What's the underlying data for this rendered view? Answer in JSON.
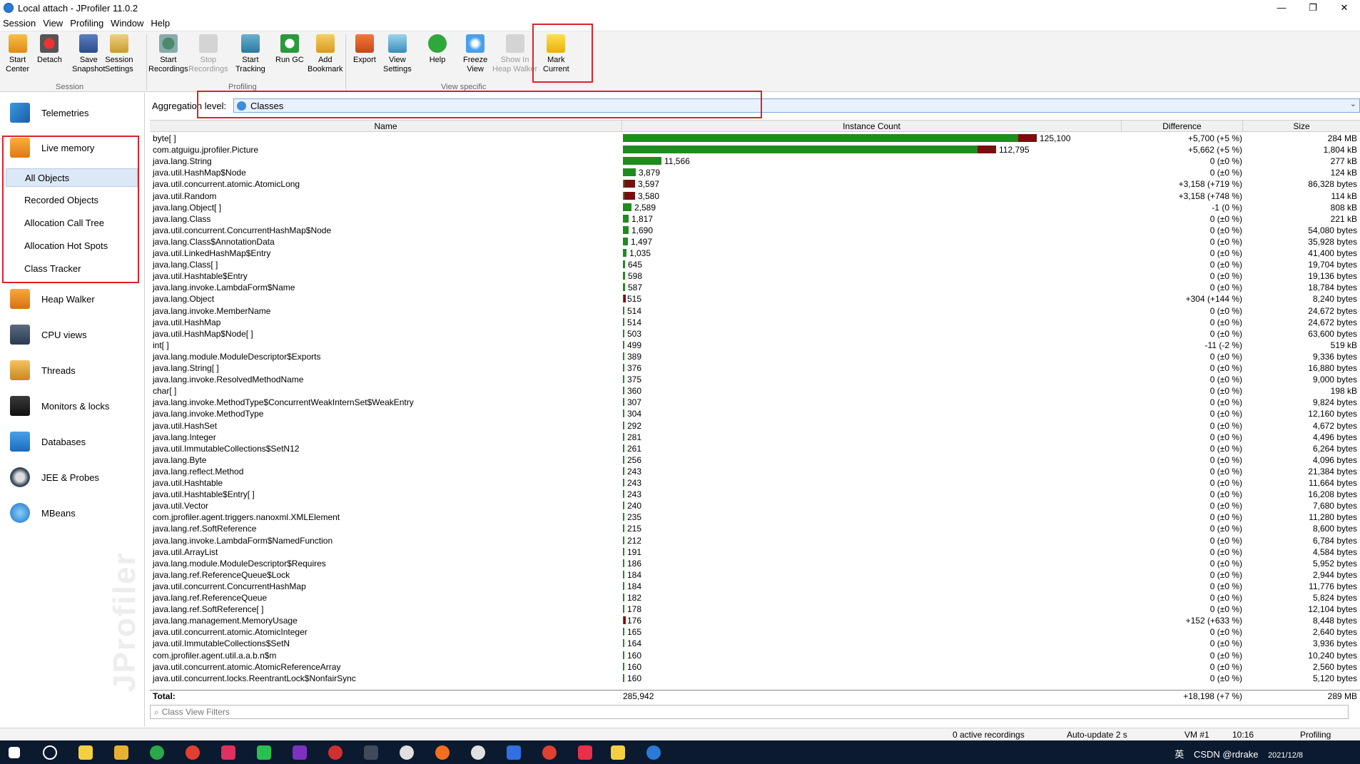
{
  "window": {
    "title": "Local attach - JProfiler 11.0.2",
    "controls": [
      "—",
      "❐",
      "✕"
    ]
  },
  "menu": [
    "Session",
    "View",
    "Profiling",
    "Window",
    "Help"
  ],
  "toolbar": {
    "session": [
      {
        "l1": "Start",
        "l2": "Center"
      },
      {
        "l1": "",
        "l2": "Detach"
      },
      {
        "l1": "Save",
        "l2": "Snapshot"
      },
      {
        "l1": "Session",
        "l2": "Settings"
      }
    ],
    "profiling": [
      {
        "l1": "Start",
        "l2": "Recordings"
      },
      {
        "l1": "Stop",
        "l2": "Recordings"
      },
      {
        "l1": "Start",
        "l2": "Tracking"
      },
      {
        "l1": "",
        "l2": "Run GC"
      },
      {
        "l1": "Add",
        "l2": "Bookmark"
      }
    ],
    "view": [
      {
        "l1": "",
        "l2": "Export"
      },
      {
        "l1": "View",
        "l2": "Settings"
      },
      {
        "l1": "",
        "l2": "Help"
      },
      {
        "l1": "Freeze",
        "l2": "View"
      },
      {
        "l1": "Show In",
        "l2": "Heap Walker"
      },
      {
        "l1": "Mark",
        "l2": "Current"
      }
    ],
    "groups": {
      "session": "Session",
      "profiling": "Profiling",
      "view": "View specific"
    }
  },
  "sidebar": {
    "telemetries": "Telemetries",
    "live_memory": "Live memory",
    "subs": [
      "All Objects",
      "Recorded Objects",
      "Allocation Call Tree",
      "Allocation Hot Spots",
      "Class Tracker"
    ],
    "items": [
      "Heap Walker",
      "CPU views",
      "Threads",
      "Monitors & locks",
      "Databases",
      "JEE & Probes",
      "MBeans"
    ],
    "watermark": "JProfiler"
  },
  "aggregation": {
    "label": "Aggregation level:",
    "value": "Classes"
  },
  "table": {
    "headers": {
      "name": "Name",
      "count": "Instance Count",
      "diff": "Difference",
      "size": "Size"
    },
    "max_count": 125100,
    "rows": [
      {
        "name": "byte[ ]",
        "count": "125,100",
        "n": 125100,
        "d": 5700,
        "diff": "+5,700 (+5 %)",
        "size": "284 MB"
      },
      {
        "name": "com.atguigu.jprofiler.Picture",
        "count": "112,795",
        "n": 112795,
        "d": 5662,
        "diff": "+5,662 (+5 %)",
        "size": "1,804 kB"
      },
      {
        "name": "java.lang.String",
        "count": "11,566",
        "n": 11566,
        "d": 0,
        "diff": "0 (±0 %)",
        "size": "277 kB"
      },
      {
        "name": "java.util.HashMap$Node",
        "count": "3,879",
        "n": 3879,
        "d": 0,
        "diff": "0 (±0 %)",
        "size": "124 kB"
      },
      {
        "name": "java.util.concurrent.atomic.AtomicLong",
        "count": "3,597",
        "n": 3597,
        "d": 3158,
        "diff": "+3,158 (+719 %)",
        "size": "86,328 bytes"
      },
      {
        "name": "java.util.Random",
        "count": "3,580",
        "n": 3580,
        "d": 3158,
        "diff": "+3,158 (+748 %)",
        "size": "114 kB"
      },
      {
        "name": "java.lang.Object[ ]",
        "count": "2,589",
        "n": 2589,
        "d": 0,
        "diff": "-1 (0 %)",
        "size": "808 kB"
      },
      {
        "name": "java.lang.Class",
        "count": "1,817",
        "n": 1817,
        "d": 0,
        "diff": "0 (±0 %)",
        "size": "221 kB"
      },
      {
        "name": "java.util.concurrent.ConcurrentHashMap$Node",
        "count": "1,690",
        "n": 1690,
        "d": 0,
        "diff": "0 (±0 %)",
        "size": "54,080 bytes"
      },
      {
        "name": "java.lang.Class$AnnotationData",
        "count": "1,497",
        "n": 1497,
        "d": 0,
        "diff": "0 (±0 %)",
        "size": "35,928 bytes"
      },
      {
        "name": "java.util.LinkedHashMap$Entry",
        "count": "1,035",
        "n": 1035,
        "d": 0,
        "diff": "0 (±0 %)",
        "size": "41,400 bytes"
      },
      {
        "name": "java.lang.Class[ ]",
        "count": "645",
        "n": 645,
        "d": 0,
        "diff": "0 (±0 %)",
        "size": "19,704 bytes"
      },
      {
        "name": "java.util.Hashtable$Entry",
        "count": "598",
        "n": 598,
        "d": 0,
        "diff": "0 (±0 %)",
        "size": "19,136 bytes"
      },
      {
        "name": "java.lang.invoke.LambdaForm$Name",
        "count": "587",
        "n": 587,
        "d": 0,
        "diff": "0 (±0 %)",
        "size": "18,784 bytes"
      },
      {
        "name": "java.lang.Object",
        "count": "515",
        "n": 515,
        "d": 304,
        "diff": "+304 (+144 %)",
        "size": "8,240 bytes"
      },
      {
        "name": "java.lang.invoke.MemberName",
        "count": "514",
        "n": 514,
        "d": 0,
        "diff": "0 (±0 %)",
        "size": "24,672 bytes"
      },
      {
        "name": "java.util.HashMap",
        "count": "514",
        "n": 514,
        "d": 0,
        "diff": "0 (±0 %)",
        "size": "24,672 bytes"
      },
      {
        "name": "java.util.HashMap$Node[ ]",
        "count": "503",
        "n": 503,
        "d": 0,
        "diff": "0 (±0 %)",
        "size": "63,600 bytes"
      },
      {
        "name": "int[ ]",
        "count": "499",
        "n": 499,
        "d": 0,
        "diff": "-11 (-2 %)",
        "size": "519 kB"
      },
      {
        "name": "java.lang.module.ModuleDescriptor$Exports",
        "count": "389",
        "n": 389,
        "d": 0,
        "diff": "0 (±0 %)",
        "size": "9,336 bytes"
      },
      {
        "name": "java.lang.String[ ]",
        "count": "376",
        "n": 376,
        "d": 0,
        "diff": "0 (±0 %)",
        "size": "16,880 bytes"
      },
      {
        "name": "java.lang.invoke.ResolvedMethodName",
        "count": "375",
        "n": 375,
        "d": 0,
        "diff": "0 (±0 %)",
        "size": "9,000 bytes"
      },
      {
        "name": "char[ ]",
        "count": "360",
        "n": 360,
        "d": 0,
        "diff": "0 (±0 %)",
        "size": "198 kB"
      },
      {
        "name": "java.lang.invoke.MethodType$ConcurrentWeakInternSet$WeakEntry",
        "count": "307",
        "n": 307,
        "d": 0,
        "diff": "0 (±0 %)",
        "size": "9,824 bytes"
      },
      {
        "name": "java.lang.invoke.MethodType",
        "count": "304",
        "n": 304,
        "d": 0,
        "diff": "0 (±0 %)",
        "size": "12,160 bytes"
      },
      {
        "name": "java.util.HashSet",
        "count": "292",
        "n": 292,
        "d": 0,
        "diff": "0 (±0 %)",
        "size": "4,672 bytes"
      },
      {
        "name": "java.lang.Integer",
        "count": "281",
        "n": 281,
        "d": 0,
        "diff": "0 (±0 %)",
        "size": "4,496 bytes"
      },
      {
        "name": "java.util.ImmutableCollections$SetN12",
        "count": "261",
        "n": 261,
        "d": 0,
        "diff": "0 (±0 %)",
        "size": "6,264 bytes"
      },
      {
        "name": "java.lang.Byte",
        "count": "256",
        "n": 256,
        "d": 0,
        "diff": "0 (±0 %)",
        "size": "4,096 bytes"
      },
      {
        "name": "java.lang.reflect.Method",
        "count": "243",
        "n": 243,
        "d": 0,
        "diff": "0 (±0 %)",
        "size": "21,384 bytes"
      },
      {
        "name": "java.util.Hashtable",
        "count": "243",
        "n": 243,
        "d": 0,
        "diff": "0 (±0 %)",
        "size": "11,664 bytes"
      },
      {
        "name": "java.util.Hashtable$Entry[ ]",
        "count": "243",
        "n": 243,
        "d": 0,
        "diff": "0 (±0 %)",
        "size": "16,208 bytes"
      },
      {
        "name": "java.util.Vector",
        "count": "240",
        "n": 240,
        "d": 0,
        "diff": "0 (±0 %)",
        "size": "7,680 bytes"
      },
      {
        "name": "com.jprofiler.agent.triggers.nanoxml.XMLElement",
        "count": "235",
        "n": 235,
        "d": 0,
        "diff": "0 (±0 %)",
        "size": "11,280 bytes"
      },
      {
        "name": "java.lang.ref.SoftReference",
        "count": "215",
        "n": 215,
        "d": 0,
        "diff": "0 (±0 %)",
        "size": "8,600 bytes"
      },
      {
        "name": "java.lang.invoke.LambdaForm$NamedFunction",
        "count": "212",
        "n": 212,
        "d": 0,
        "diff": "0 (±0 %)",
        "size": "6,784 bytes"
      },
      {
        "name": "java.util.ArrayList",
        "count": "191",
        "n": 191,
        "d": 0,
        "diff": "0 (±0 %)",
        "size": "4,584 bytes"
      },
      {
        "name": "java.lang.module.ModuleDescriptor$Requires",
        "count": "186",
        "n": 186,
        "d": 0,
        "diff": "0 (±0 %)",
        "size": "5,952 bytes"
      },
      {
        "name": "java.lang.ref.ReferenceQueue$Lock",
        "count": "184",
        "n": 184,
        "d": 0,
        "diff": "0 (±0 %)",
        "size": "2,944 bytes"
      },
      {
        "name": "java.util.concurrent.ConcurrentHashMap",
        "count": "184",
        "n": 184,
        "d": 0,
        "diff": "0 (±0 %)",
        "size": "11,776 bytes"
      },
      {
        "name": "java.lang.ref.ReferenceQueue",
        "count": "182",
        "n": 182,
        "d": 0,
        "diff": "0 (±0 %)",
        "size": "5,824 bytes"
      },
      {
        "name": "java.lang.ref.SoftReference[ ]",
        "count": "178",
        "n": 178,
        "d": 0,
        "diff": "0 (±0 %)",
        "size": "12,104 bytes"
      },
      {
        "name": "java.lang.management.MemoryUsage",
        "count": "176",
        "n": 176,
        "d": 152,
        "diff": "+152 (+633 %)",
        "size": "8,448 bytes"
      },
      {
        "name": "java.util.concurrent.atomic.AtomicInteger",
        "count": "165",
        "n": 165,
        "d": 0,
        "diff": "0 (±0 %)",
        "size": "2,640 bytes"
      },
      {
        "name": "java.util.ImmutableCollections$SetN",
        "count": "164",
        "n": 164,
        "d": 0,
        "diff": "0 (±0 %)",
        "size": "3,936 bytes"
      },
      {
        "name": "com.jprofiler.agent.util.a.a.b.n$m",
        "count": "160",
        "n": 160,
        "d": 0,
        "diff": "0 (±0 %)",
        "size": "10,240 bytes"
      },
      {
        "name": "java.util.concurrent.atomic.AtomicReferenceArray",
        "count": "160",
        "n": 160,
        "d": 0,
        "diff": "0 (±0 %)",
        "size": "2,560 bytes"
      },
      {
        "name": "java.util.concurrent.locks.ReentrantLock$NonfairSync",
        "count": "160",
        "n": 160,
        "d": 0,
        "diff": "0 (±0 %)",
        "size": "5,120 bytes"
      }
    ],
    "total": {
      "label": "Total:",
      "count": "285,942",
      "diff": "+18,198 (+7 %)",
      "size": "289 MB"
    }
  },
  "filter_placeholder": "Class View Filters",
  "status": {
    "recordings": "0 active recordings",
    "autoupdate": "Auto-update 2 s",
    "vm": "VM #1",
    "time": "10:16",
    "mode": "Profiling"
  },
  "taskbar": {
    "watermark": "CSDN @rdrake",
    "date": "2021/12/8",
    "lang": "英"
  }
}
